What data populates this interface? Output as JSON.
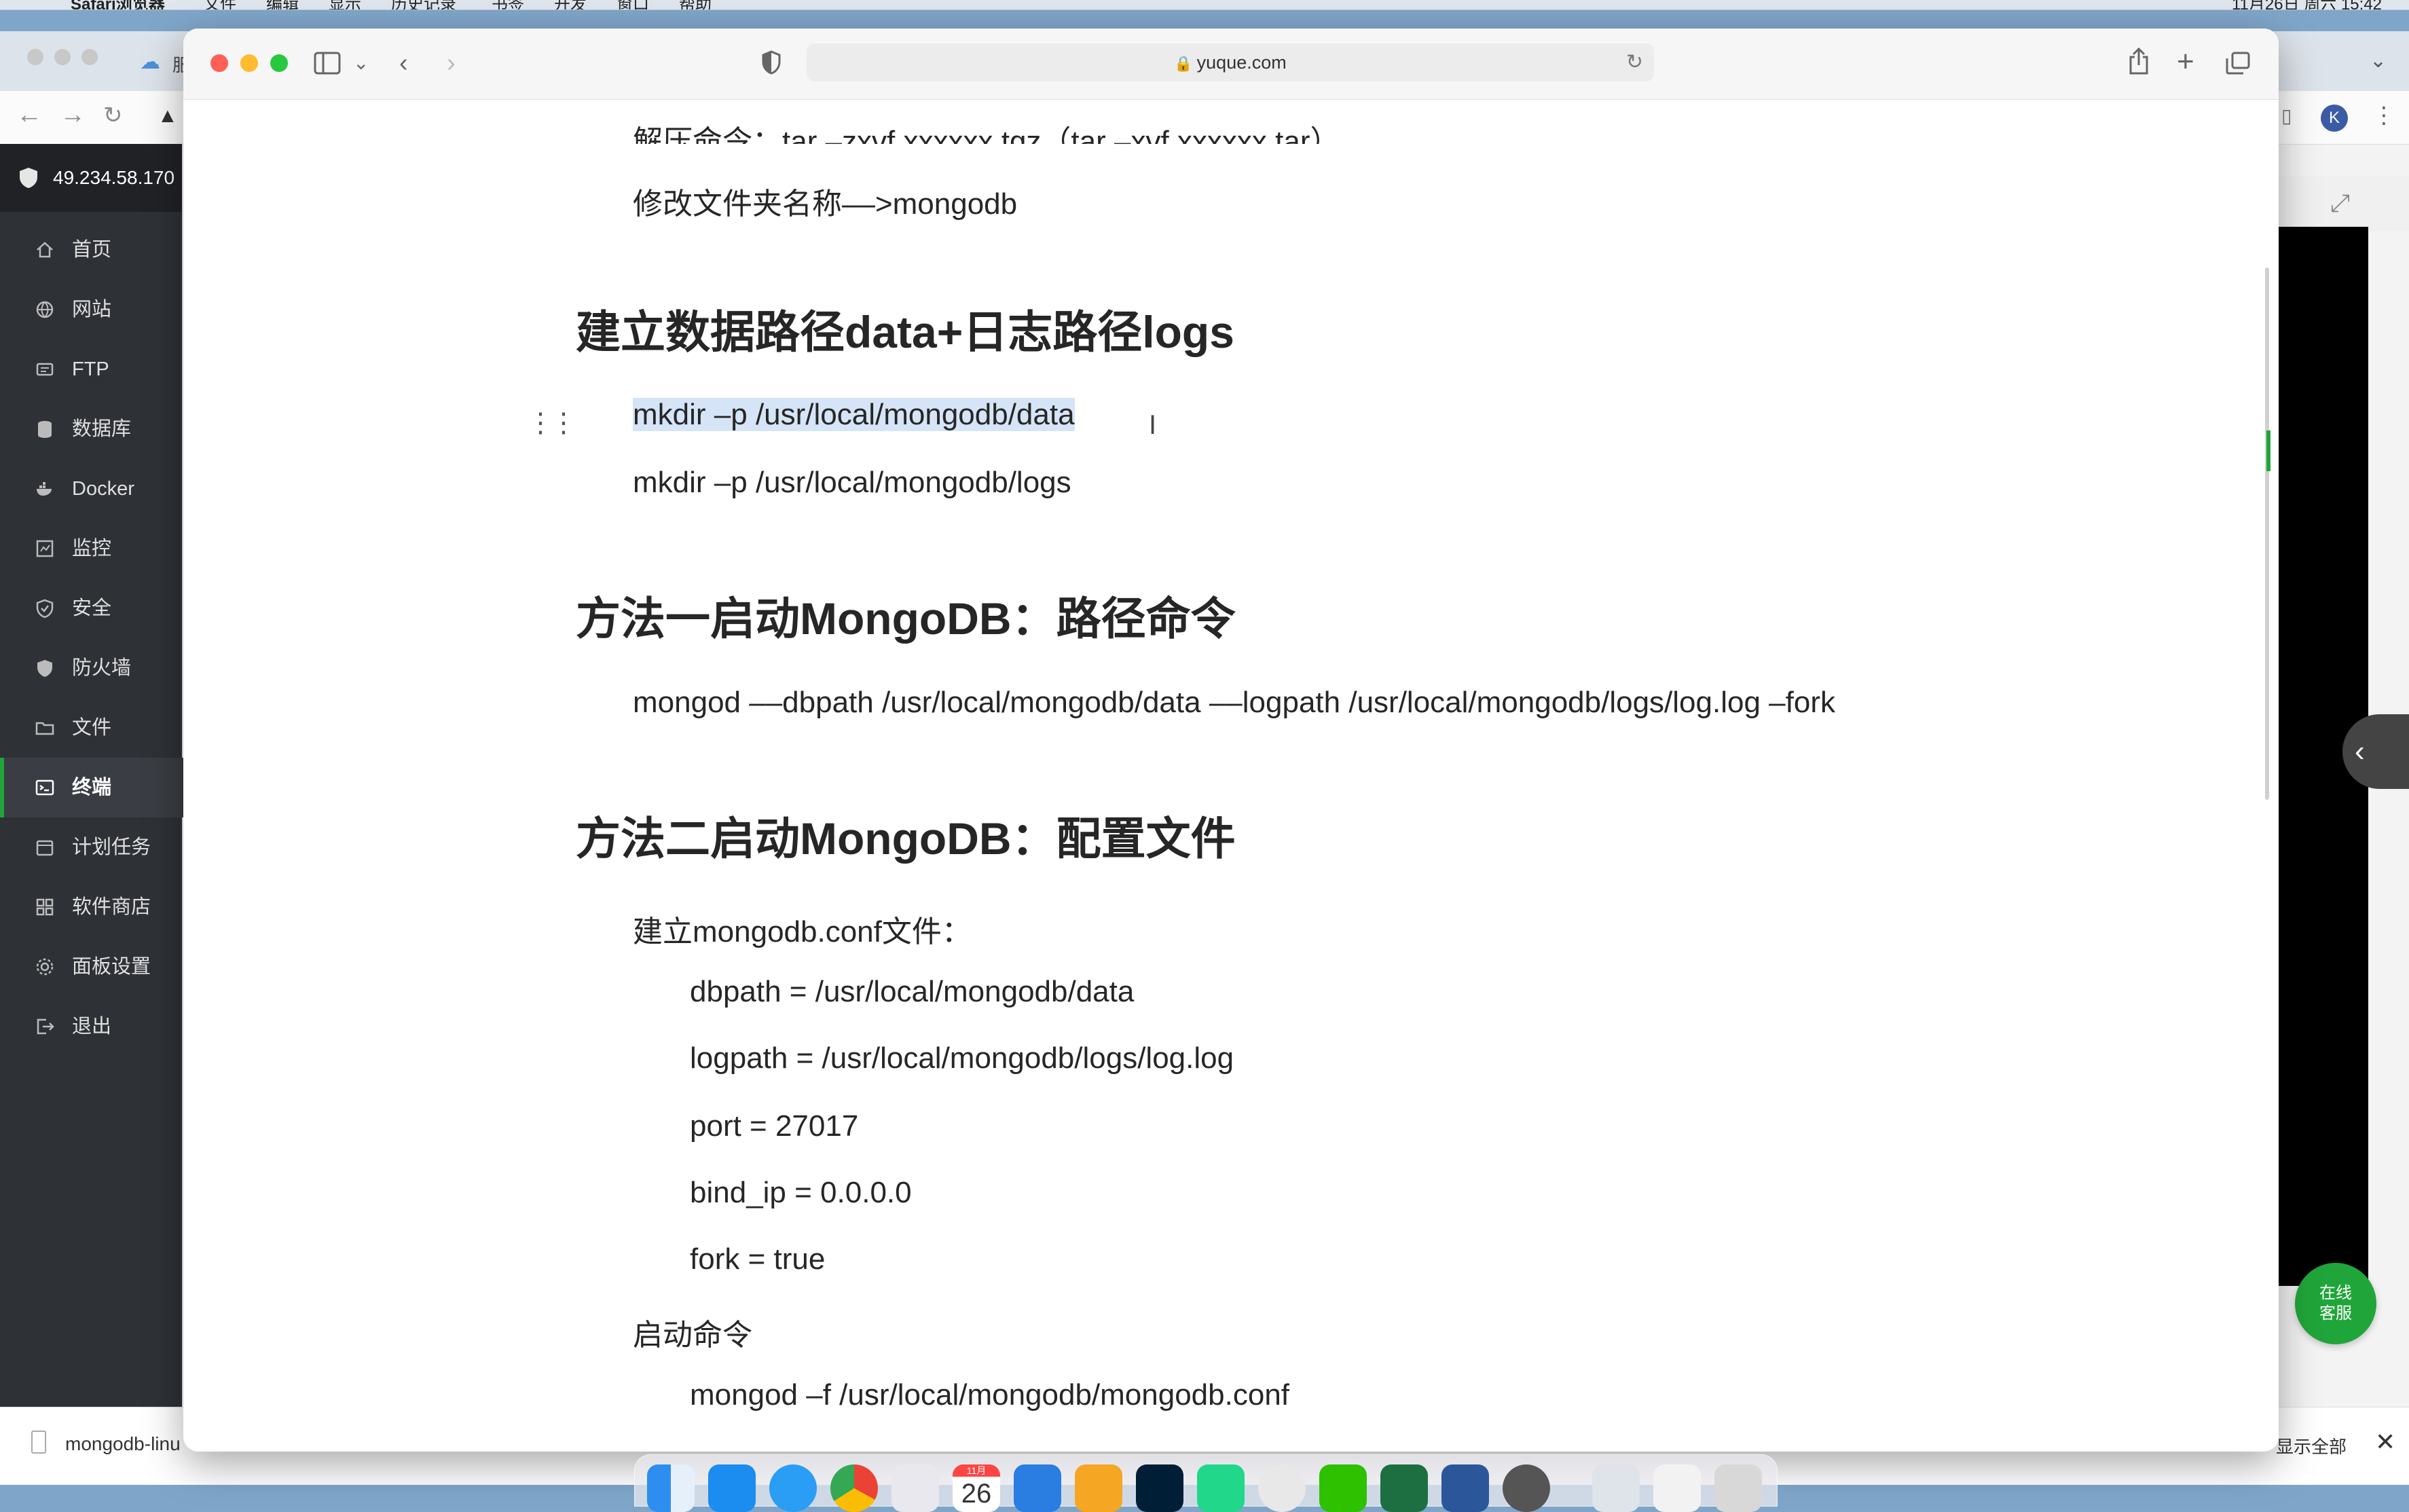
{
  "menubar": {
    "app_name": "Safari浏览器",
    "items": [
      "文件",
      "编辑",
      "显示",
      "历史记录",
      "书签",
      "开发",
      "窗口",
      "帮助"
    ],
    "clock": "11月26日 周六 15:42"
  },
  "background_browser": {
    "tab_label": "服",
    "avatar_letter": "K",
    "download": {
      "file_name": "mongodb-linu",
      "show_all": "显示全部"
    },
    "online_service": "在线客服"
  },
  "panel": {
    "server_ip": "49.234.58.170",
    "menu": [
      {
        "label": "首页",
        "icon": "home-icon"
      },
      {
        "label": "网站",
        "icon": "globe-icon"
      },
      {
        "label": "FTP",
        "icon": "ftp-icon"
      },
      {
        "label": "数据库",
        "icon": "database-icon"
      },
      {
        "label": "Docker",
        "icon": "docker-icon"
      },
      {
        "label": "监控",
        "icon": "monitor-icon"
      },
      {
        "label": "安全",
        "icon": "shield-icon"
      },
      {
        "label": "防火墙",
        "icon": "firewall-icon"
      },
      {
        "label": "文件",
        "icon": "folder-icon"
      },
      {
        "label": "终端",
        "icon": "terminal-icon",
        "active": true
      },
      {
        "label": "计划任务",
        "icon": "calendar-icon"
      },
      {
        "label": "软件商店",
        "icon": "grid-icon"
      },
      {
        "label": "面板设置",
        "icon": "gear-icon"
      },
      {
        "label": "退出",
        "icon": "logout-icon"
      }
    ]
  },
  "safari": {
    "url": "yuque.com"
  },
  "document": {
    "line_unzip": "解压命令：tar –zxvf xxxxxx.tgz（tar –xvf xxxxxx.tar）",
    "line_rename": "修改文件夹名称––>mongodb",
    "heading1": "建立数据路径data+日志路径logs",
    "cmd_data": "mkdir –p /usr/local/mongodb/data",
    "cmd_logs": "mkdir –p /usr/local/mongodb/logs",
    "heading2": "方法一启动MongoDB：路径命令",
    "cmd_mongod": "mongod ––dbpath /usr/local/mongodb/data ––logpath /usr/local/mongodb/logs/log.log –fork",
    "heading3": "方法二启动MongoDB：配置文件",
    "conf_intro": "建立mongodb.conf文件：",
    "conf_lines": [
      "dbpath = /usr/local/mongodb/data",
      "logpath = /usr/local/mongodb/logs/log.log",
      "port = 27017",
      "bind_ip = 0.0.0.0",
      "fork = true"
    ],
    "start_label": "启动命令",
    "start_cmd": "mongod –f /usr/local/mongodb/mongodb.conf"
  },
  "dock": {
    "calendar_month": "11月",
    "calendar_day": "26"
  },
  "colors": {
    "accent_green": "#20a53a",
    "sidebar_bg": "#2e3136",
    "selection": "#d6e4f7"
  }
}
